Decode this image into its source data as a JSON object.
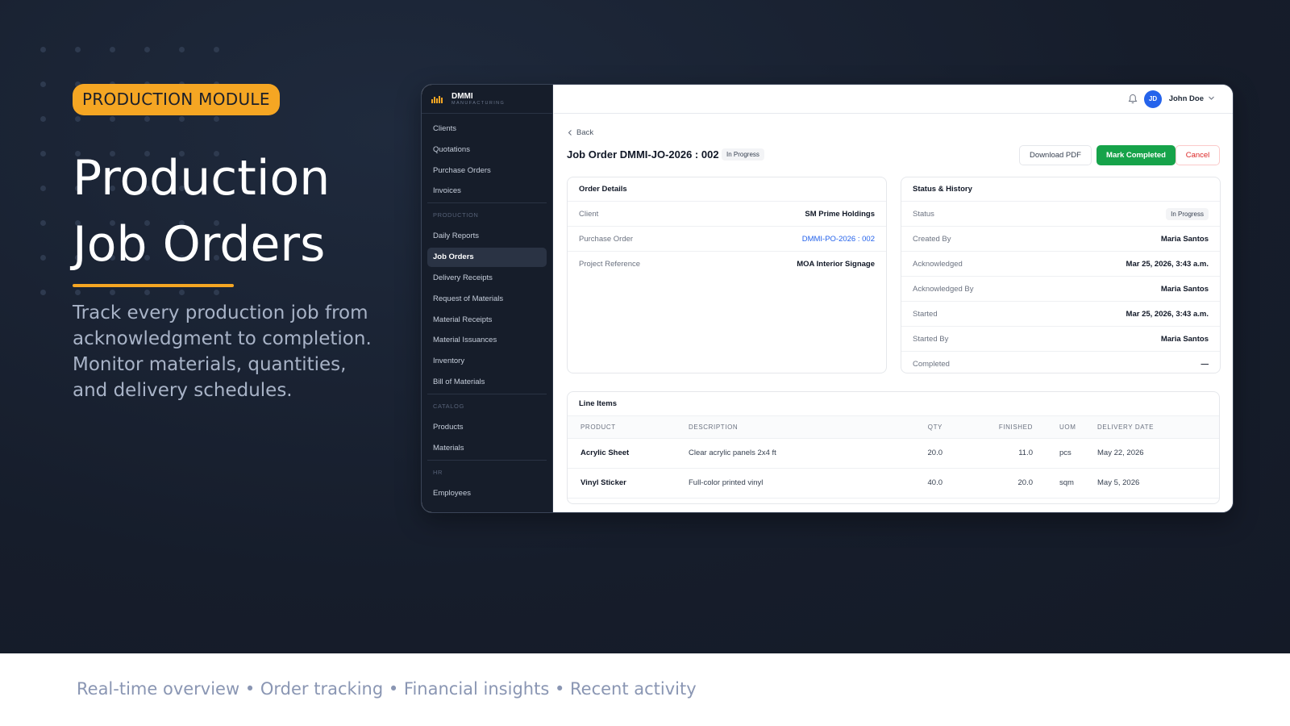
{
  "hero": {
    "badge": "PRODUCTION MODULE",
    "title_line1": "Production",
    "title_line2": "Job Orders",
    "subtitle": "Track every production job from acknowledgment to completion. Monitor materials, quantities, and delivery schedules.",
    "accent_color": "#f5a623"
  },
  "footer": {
    "text": "Real-time overview • Order tracking • Financial insights • Recent activity"
  },
  "app": {
    "brand": {
      "name": "DMMI",
      "sub": "MANUFACTURING"
    },
    "sidebar": {
      "items_top": [
        "Clients",
        "Quotations",
        "Purchase Orders",
        "Invoices"
      ],
      "section_production": "PRODUCTION",
      "items_production": [
        "Daily Reports",
        "Job Orders",
        "Delivery Receipts",
        "Request of Materials",
        "Material Receipts",
        "Material Issuances",
        "Inventory",
        "Bill of Materials"
      ],
      "section_catalog": "CATALOG",
      "items_catalog": [
        "Products",
        "Materials"
      ],
      "section_hr": "HR",
      "items_hr": [
        "Employees"
      ],
      "active_item": "Job Orders"
    },
    "topbar": {
      "avatar_initials": "JD",
      "user_name": "John Doe",
      "icons": [
        "bell-icon",
        "chevron-down-icon"
      ]
    },
    "page": {
      "back_label": "Back",
      "title": "Job Order DMMI-JO-2026 : 002",
      "status": "In Progress",
      "buttons": {
        "download_pdf": "Download PDF",
        "mark_completed": "Mark Completed",
        "cancel": "Cancel"
      },
      "button_colors": {
        "complete": "#16a34a",
        "cancel": "#dc2626"
      }
    },
    "order_details": {
      "heading": "Order Details",
      "rows": [
        {
          "key": "Client",
          "value": "SM Prime Holdings"
        },
        {
          "key": "Purchase Order",
          "value": "DMMI-PO-2026 : 002"
        },
        {
          "key": "Project Reference",
          "value": "MOA Interior Signage"
        }
      ]
    },
    "status_history": {
      "heading": "Status & History",
      "status_label": "Status",
      "status_value": "In Progress",
      "rows": [
        {
          "key": "Created By",
          "value": "Maria Santos"
        },
        {
          "key": "Acknowledged",
          "value": "Mar 25, 2026, 3:43 a.m."
        },
        {
          "key": "Acknowledged By",
          "value": "Maria Santos"
        },
        {
          "key": "Started",
          "value": "Mar 25, 2026, 3:43 a.m."
        },
        {
          "key": "Started By",
          "value": "Maria Santos"
        },
        {
          "key": "Completed",
          "value": "—"
        }
      ]
    },
    "line_items": {
      "heading": "Line Items",
      "columns": [
        "PRODUCT",
        "DESCRIPTION",
        "QTY",
        "FINISHED",
        "UOM",
        "DELIVERY DATE"
      ],
      "rows": [
        {
          "product": "Acrylic Sheet",
          "description": "Clear acrylic panels 2x4 ft",
          "qty": "20.0",
          "finished": "11.0",
          "uom": "pcs",
          "delivery": "May 22, 2026"
        },
        {
          "product": "Vinyl Sticker",
          "description": "Full-color printed vinyl",
          "qty": "40.0",
          "finished": "20.0",
          "uom": "sqm",
          "delivery": "May 5, 2026"
        }
      ]
    }
  }
}
